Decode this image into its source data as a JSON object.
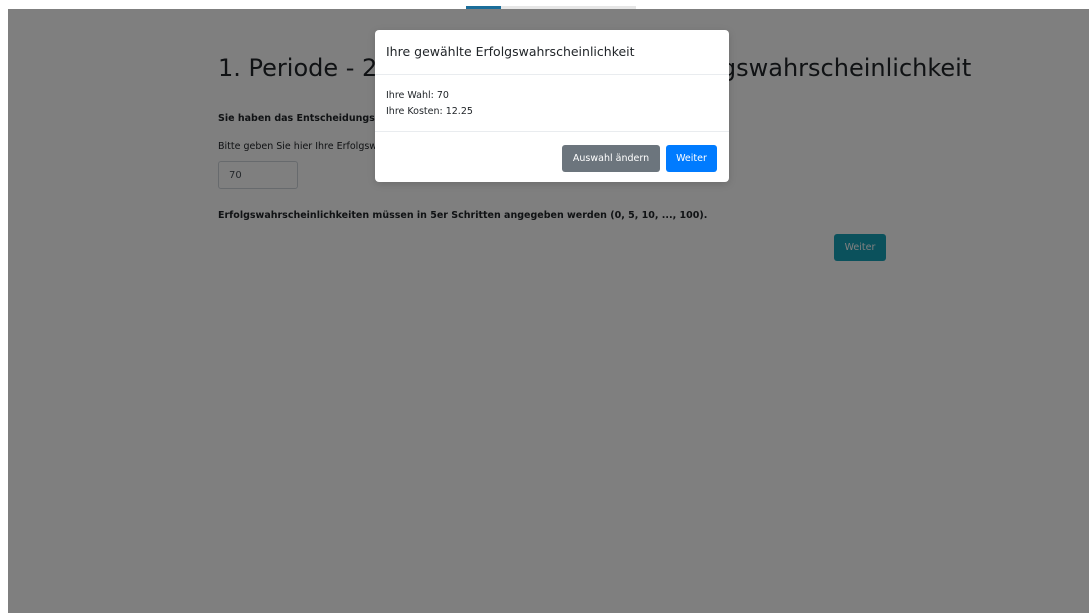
{
  "page": {
    "title": "1. Periode - 2. Stufe: Wählen Sie Ihre Erfolgswahrscheinlichkeit",
    "decision_heading": "Sie haben das Entscheidungsrecht.",
    "prompt": "Bitte geben Sie hier Ihre Erfolgswahrscheinlichkeit an:",
    "input_value": "70",
    "hint": "Erfolgswahrscheinlichkeiten müssen in 5er Schritten angegeben werden (0, 5, 10, ..., 100).",
    "next_label": "Weiter"
  },
  "modal": {
    "title": "Ihre gewählte Erfolgswahrscheinlichkeit",
    "choice_line": "Ihre Wahl: 70",
    "cost_line": "Ihre Kosten: 12.25",
    "change_label": "Auswahl ändern",
    "confirm_label": "Weiter"
  },
  "colors": {
    "primary": "#007bff",
    "secondary": "#6c757d",
    "info": "#17a2b8"
  }
}
